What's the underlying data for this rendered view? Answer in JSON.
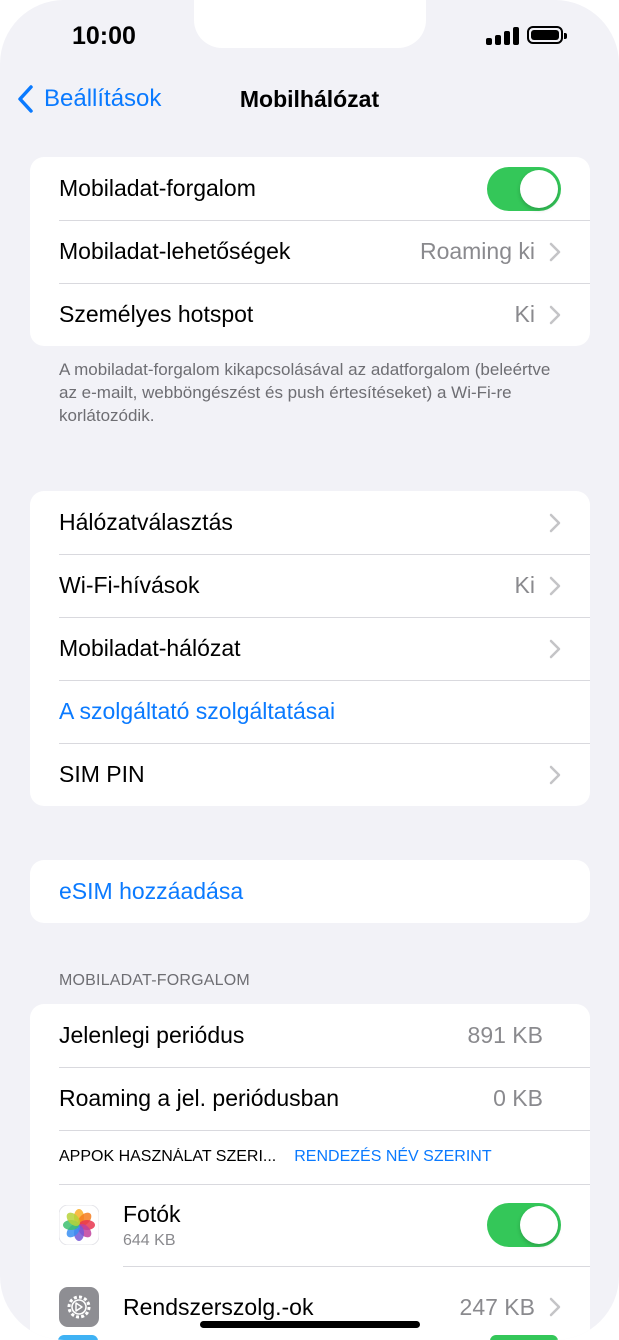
{
  "status_bar": {
    "time": "10:00"
  },
  "nav": {
    "back_label": "Beállítások",
    "title": "Mobilhálózat"
  },
  "group1": {
    "mobile_data": {
      "label": "Mobiladat-forgalom",
      "toggle_on": true
    },
    "data_options": {
      "label": "Mobiladat-lehetőségek",
      "value": "Roaming ki"
    },
    "hotspot": {
      "label": "Személyes hotspot",
      "value": "Ki"
    }
  },
  "group1_footer": "A mobiladat-forgalom kikapcsolásával az adatforgalom (beleértve az e-mailt, webböngészést és push értesítéseket) a Wi-Fi-re korlátozódik.",
  "group2": {
    "network_selection": {
      "label": "Hálózatválasztás"
    },
    "wifi_calling": {
      "label": "Wi-Fi-hívások",
      "value": "Ki"
    },
    "cellular_network": {
      "label": "Mobiladat-hálózat"
    },
    "carrier_services": {
      "label": "A szolgáltató szolgáltatásai"
    },
    "sim_pin": {
      "label": "SIM PIN"
    }
  },
  "esim": {
    "label": "eSIM hozzáadása"
  },
  "usage_section": {
    "header": "MOBILADAT-FORGALOM",
    "current_period": {
      "label": "Jelenlegi periódus",
      "value": "891 KB"
    },
    "roaming_period": {
      "label": "Roaming a jel. periódusban",
      "value": "0 KB"
    },
    "sort_label": "APPOK HASZNÁLAT SZERI...",
    "sort_action": "RENDEZÉS NÉV SZERINT",
    "apps": [
      {
        "name": "Fotók",
        "usage": "644 KB",
        "icon": "photos-icon",
        "toggle_on": true
      },
      {
        "name": "Rendszerszolg.-ok",
        "value": "247 KB",
        "icon": "system-services-gear-icon"
      }
    ]
  },
  "colors": {
    "accent": "#0a7aff",
    "toggle_on": "#34c759",
    "background": "#f2f2f7"
  }
}
